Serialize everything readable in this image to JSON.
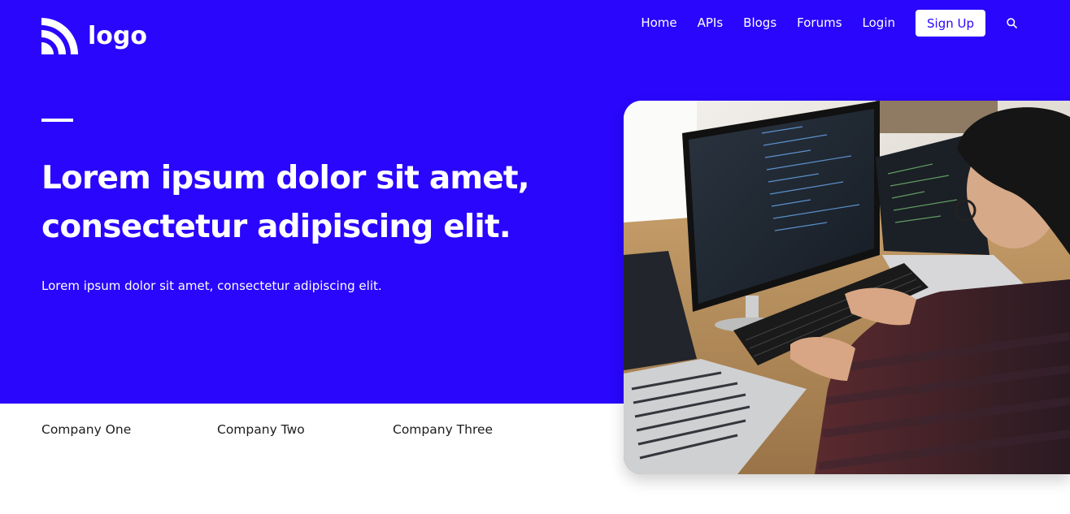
{
  "header": {
    "logo_text": "logo",
    "logo_icon": "wifi-signal-icon",
    "nav": {
      "home": "Home",
      "apis": "APIs",
      "blogs": "Blogs",
      "forums": "Forums",
      "login": "Login",
      "signup": "Sign Up"
    },
    "search_icon": "search-icon"
  },
  "hero": {
    "headline_line1": "Lorem ipsum dolor sit amet,",
    "headline_line2": "consectetur adipiscing elit.",
    "subtext": "Lorem ipsum dolor sit amet, consectetur adipiscing elit."
  },
  "companies": [
    "Company One",
    "Company Two",
    "Company Three"
  ],
  "colors": {
    "brand_blue": "#2a06fd",
    "white": "#ffffff",
    "text_dark": "#1c1c1c"
  }
}
